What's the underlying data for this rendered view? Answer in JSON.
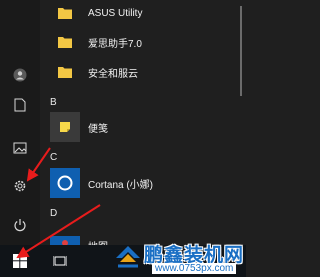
{
  "start_menu": {
    "apps": [
      {
        "label": "ASUS Utility",
        "icon": "folder-icon"
      },
      {
        "label": "爱思助手7.0",
        "icon": "folder-icon"
      },
      {
        "label": "安全和服云",
        "icon": "folder-icon"
      },
      {
        "group": "B"
      },
      {
        "label": "便笺",
        "icon": "sticky-notes-icon"
      },
      {
        "group": "C"
      },
      {
        "label": "Cortana (小娜)",
        "icon": "cortana-icon"
      },
      {
        "group": "D"
      },
      {
        "label": "地图",
        "icon": "maps-icon"
      }
    ],
    "rail": [
      "user-icon",
      "document-icon",
      "pictures-icon",
      "settings-gear-icon",
      "power-icon"
    ]
  },
  "taskbar": {
    "items": [
      "windows-start-icon",
      "task-view-icon"
    ]
  },
  "watermark": {
    "title": "鹏鑫装机网",
    "url": "www.0753px.com"
  },
  "colors": {
    "menu_bg": "#1f1f1f",
    "tile_blue": "#0f5fb0",
    "folder_yellow": "#f3c744",
    "annotation_red": "#e81c1c"
  }
}
